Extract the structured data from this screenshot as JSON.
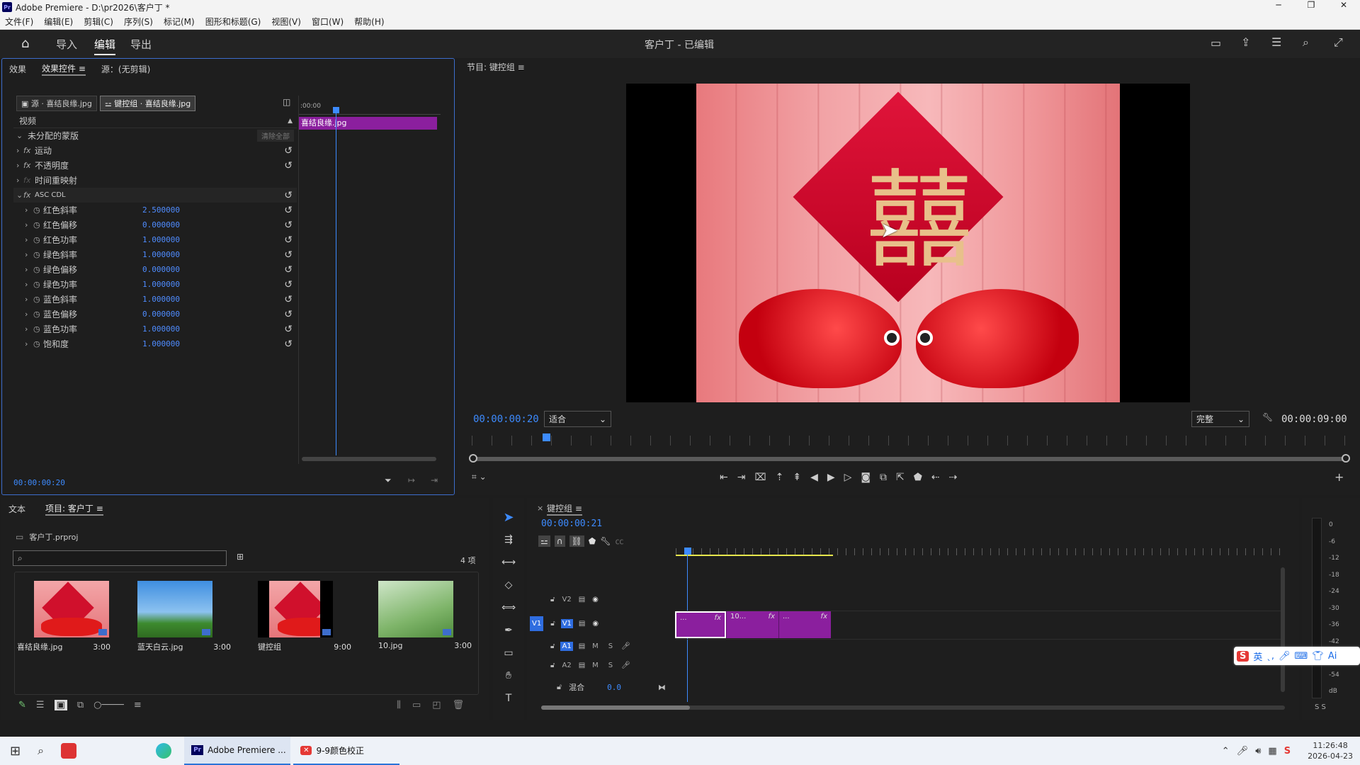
{
  "window": {
    "title": "Adobe Premiere - D:\\pr2026\\客户丁 *",
    "app_icon": "Pr"
  },
  "menu": [
    "文件(F)",
    "编辑(E)",
    "剪辑(C)",
    "序列(S)",
    "标记(M)",
    "图形和标题(G)",
    "视图(V)",
    "窗口(W)",
    "帮助(H)"
  ],
  "header": {
    "tabs": [
      "导入",
      "编辑",
      "导出"
    ],
    "active": "编辑",
    "project_title": "客户丁 - 已编辑"
  },
  "effect_controls": {
    "tabs": [
      "效果",
      "效果控件",
      "源：(无剪辑)"
    ],
    "source_btn": "源 · 喜结良缘.jpg",
    "seq_btn": "键控组 · 喜结良缘.jpg",
    "section": "视频",
    "mask_row": "未分配的蒙版",
    "clear_all": "清除全部",
    "effects": [
      "运动",
      "不透明度",
      "时间重映射"
    ],
    "asc_cdl": "ASC CDL",
    "params": [
      {
        "name": "红色斜率",
        "value": "2.500000"
      },
      {
        "name": "红色偏移",
        "value": "0.000000"
      },
      {
        "name": "红色功率",
        "value": "1.000000"
      },
      {
        "name": "绿色斜率",
        "value": "1.000000"
      },
      {
        "name": "绿色偏移",
        "value": "0.000000"
      },
      {
        "name": "绿色功率",
        "value": "1.000000"
      },
      {
        "name": "蓝色斜率",
        "value": "1.000000"
      },
      {
        "name": "蓝色偏移",
        "value": "0.000000"
      },
      {
        "name": "蓝色功率",
        "value": "1.000000"
      },
      {
        "name": "饱和度",
        "value": "1.000000"
      }
    ],
    "mini_timeline_time": ":00:00",
    "clip_label": "喜结良缘.jpg",
    "timecode": "00:00:00:20"
  },
  "program": {
    "title": "节目: 键控组",
    "timecode": "00:00:00:20",
    "fit": "适合",
    "quality": "完整",
    "duration": "00:00:09:00",
    "preview_char": "囍"
  },
  "project": {
    "tabs": [
      "文本",
      "项目: 客户丁"
    ],
    "file": "客户丁.prproj",
    "search_placeholder": "",
    "count": "4 项",
    "items": [
      {
        "name": "喜结良缘.jpg",
        "duration": "3:00"
      },
      {
        "name": "蓝天白云.jpg",
        "duration": "3:00"
      },
      {
        "name": "键控组",
        "duration": "9:00"
      },
      {
        "name": "10.jpg",
        "duration": "3:00"
      }
    ]
  },
  "timeline": {
    "title": "键控组",
    "timecode": "00:00:00:21",
    "tracks": [
      {
        "id": "V2",
        "label": "V2"
      },
      {
        "id": "V1",
        "label": "V1",
        "selected": "V1"
      },
      {
        "id": "A1",
        "label": "A1"
      },
      {
        "id": "A2",
        "label": "A2"
      }
    ],
    "mix_label": "混合",
    "mix_value": "0.0",
    "clips": [
      {
        "label": "...",
        "fx": "fx"
      },
      {
        "label": "10...",
        "fx": "fx"
      },
      {
        "label": "...",
        "fx": "fx"
      }
    ],
    "track_m": "M",
    "track_s": "S"
  },
  "audio_meter": {
    "labels": [
      "0",
      "-6",
      "-12",
      "-18",
      "-24",
      "-30",
      "-36",
      "-42",
      "-48",
      "-54",
      "dB"
    ],
    "solo": "S  S"
  },
  "ime": {
    "label": "英"
  },
  "taskbar": {
    "apps": [
      {
        "name": "Adobe Premiere ..."
      },
      {
        "name": "9-9颜色校正"
      }
    ],
    "time": "11:26:48",
    "date": "2026-04-23"
  },
  "colors": {
    "accent": "#3d8bff",
    "clip": "#8b1f9e",
    "panel_border": "#3d6dcc"
  }
}
